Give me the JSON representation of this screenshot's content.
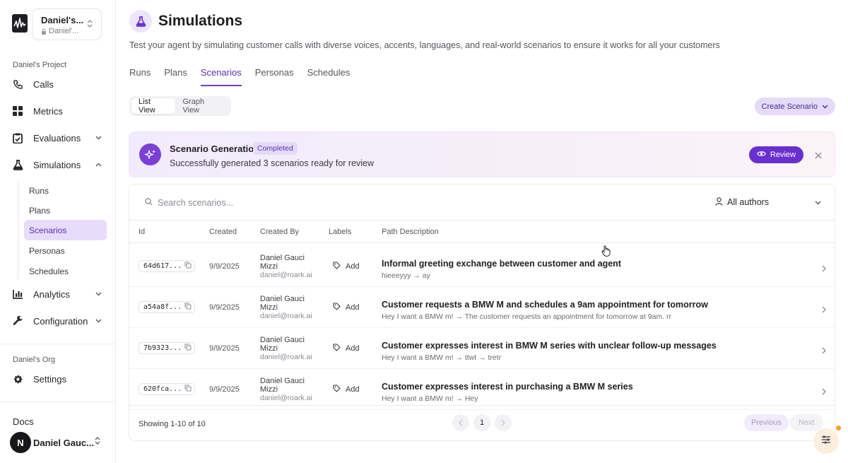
{
  "workspace": {
    "name": "Daniel's...",
    "sub": "Daniel'..."
  },
  "sidebar": {
    "project_label": "Daniel's Project",
    "items": [
      {
        "label": "Calls",
        "icon": "phone-icon"
      },
      {
        "label": "Metrics",
        "icon": "grid-icon"
      },
      {
        "label": "Evaluations",
        "icon": "clipboard-check-icon"
      },
      {
        "label": "Simulations",
        "icon": "flask-icon"
      }
    ],
    "sub_items": [
      {
        "label": "Runs"
      },
      {
        "label": "Plans"
      },
      {
        "label": "Scenarios",
        "active": true
      },
      {
        "label": "Personas"
      },
      {
        "label": "Schedules"
      }
    ],
    "items_after": [
      {
        "label": "Analytics",
        "icon": "chart-bar-icon"
      },
      {
        "label": "Configuration",
        "icon": "wrench-icon"
      }
    ],
    "org_label": "Daniel's Org",
    "settings_label": "Settings",
    "docs_label": "Docs",
    "user": {
      "initial": "N",
      "name": "Daniel Gauc..."
    }
  },
  "header": {
    "title": "Simulations",
    "subtitle": "Test your agent by simulating customer calls with diverse voices, accents, languages, and real-world scenarios to ensure it works for all your customers"
  },
  "tabs": [
    {
      "label": "Runs"
    },
    {
      "label": "Plans"
    },
    {
      "label": "Scenarios",
      "active": true
    },
    {
      "label": "Personas"
    },
    {
      "label": "Schedules"
    }
  ],
  "view_toggle": {
    "list": "List View",
    "graph": "Graph View",
    "active": "list"
  },
  "create_button": "Create Scenario",
  "banner": {
    "title": "Scenario Generation",
    "badge": "Completed",
    "text": "Successfully generated 3 scenarios ready for review",
    "review": "Review"
  },
  "search": {
    "placeholder": "Search scenarios..."
  },
  "author_filter": "All authors",
  "table": {
    "columns": [
      "Id",
      "Created",
      "Created By",
      "Labels",
      "Path Description"
    ],
    "add_label": "Add",
    "rows": [
      {
        "id": "64d617...",
        "created": "9/9/2025",
        "by_name": "Daniel Gauci Mizzi",
        "by_email": "daniel@roark.ai",
        "title": "Informal greeting exchange between customer and agent",
        "desc": "hieeeyyy → ay"
      },
      {
        "id": "a54a8f...",
        "created": "9/9/2025",
        "by_name": "Daniel Gauci Mizzi",
        "by_email": "daniel@roark.ai",
        "title": "Customer requests a BMW M and schedules a 9am appointment for tomorrow",
        "desc": "Hey I want a BMW m! → The customer requests an appointment for tomorrow at 9am. rr"
      },
      {
        "id": "7b9323...",
        "created": "9/9/2025",
        "by_name": "Daniel Gauci Mizzi",
        "by_email": "daniel@roark.ai",
        "title": "Customer expresses interest in BMW M series with unclear follow-up messages",
        "desc": "Hey I want a BMW m! → ttwt → tretr"
      },
      {
        "id": "620fca...",
        "created": "9/9/2025",
        "by_name": "Daniel Gauci Mizzi",
        "by_email": "daniel@roark.ai",
        "title": "Customer expresses interest in purchasing a BMW M series",
        "desc": "Hey I want a BMW m! → Hey"
      }
    ]
  },
  "pagination": {
    "showing": "Showing 1-10 of 10",
    "current_page": "1",
    "previous": "Previous",
    "next": "Next"
  },
  "colors": {
    "accent": "#6a30cf",
    "accent_light": "#e7dcf9",
    "notification_dot": "#f59e2b"
  }
}
